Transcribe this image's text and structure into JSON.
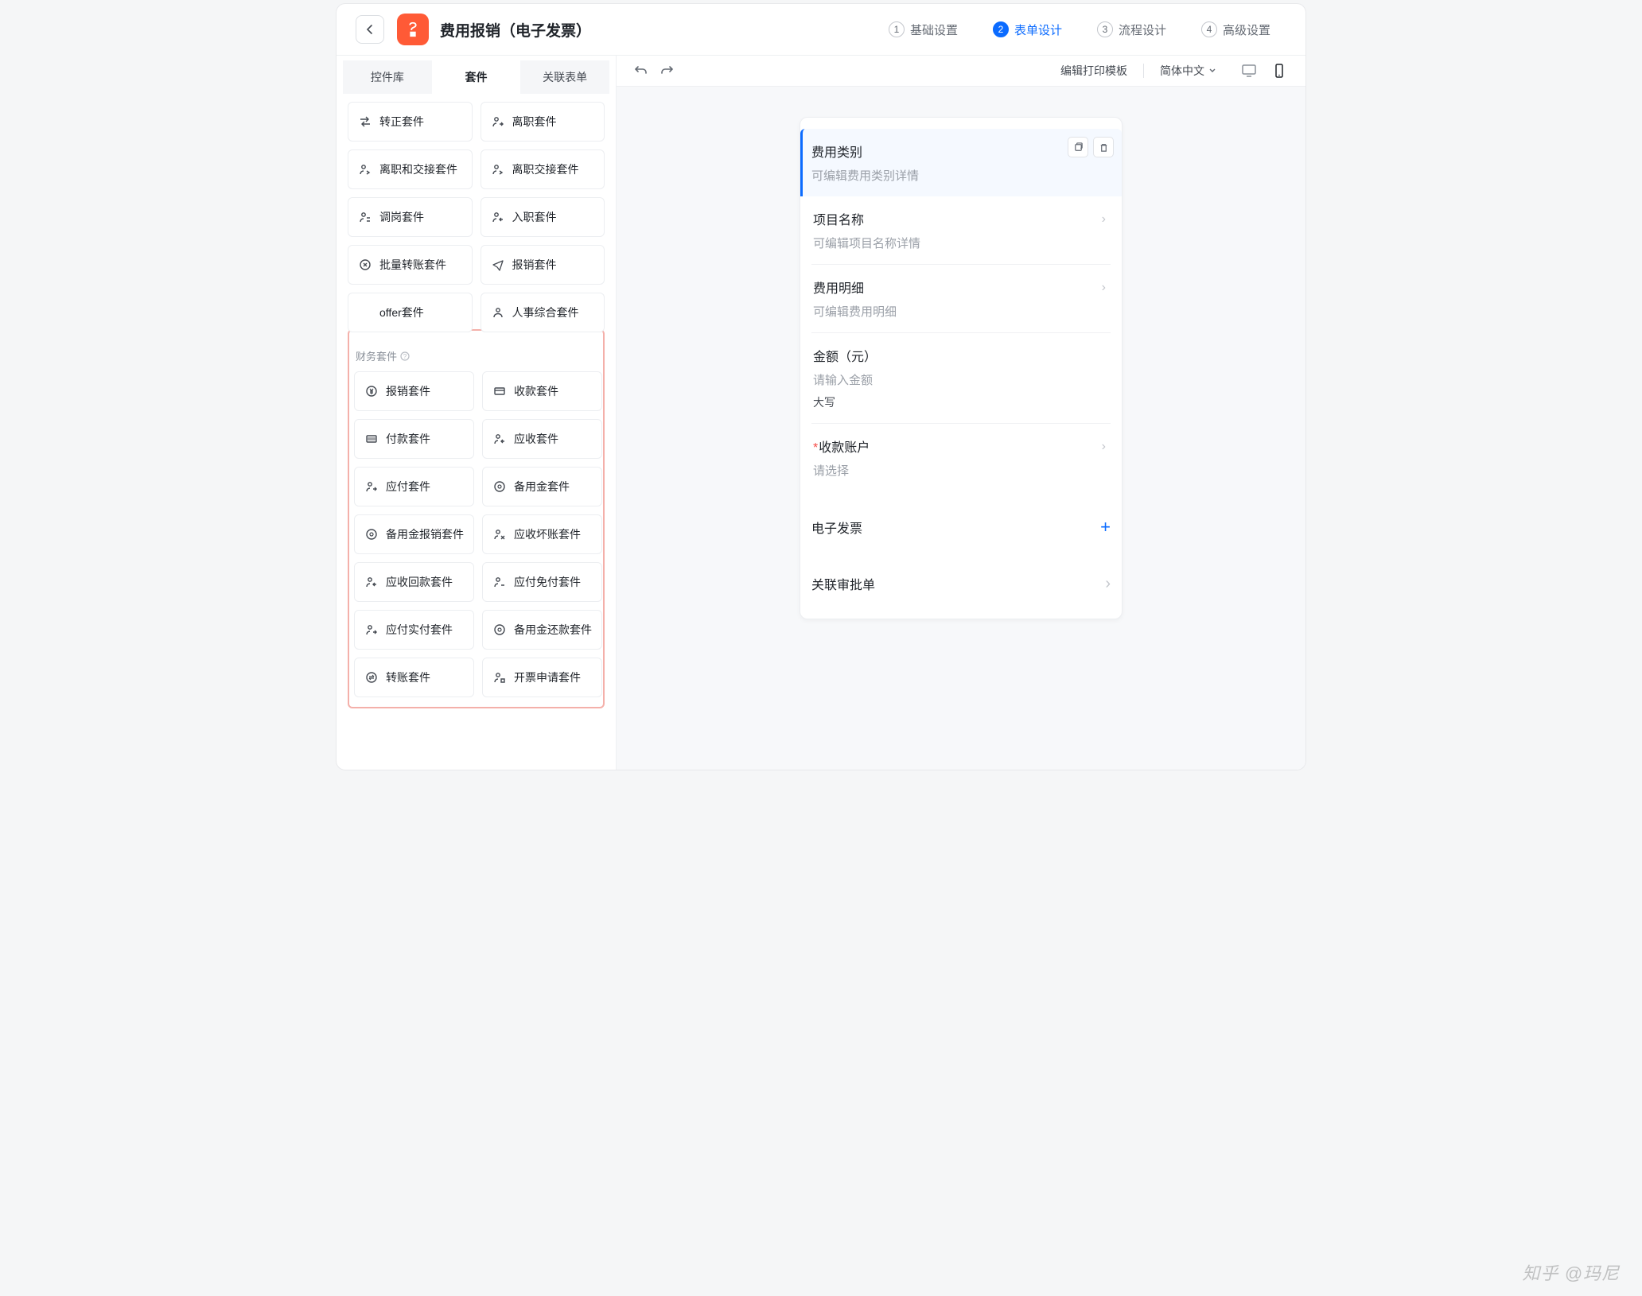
{
  "header": {
    "page_title": "费用报销（电子发票）"
  },
  "steps": [
    {
      "num": "1",
      "label": "基础设置"
    },
    {
      "num": "2",
      "label": "表单设计"
    },
    {
      "num": "3",
      "label": "流程设计"
    },
    {
      "num": "4",
      "label": "高级设置"
    }
  ],
  "sidebar": {
    "tabs": [
      "控件库",
      "套件",
      "关联表单"
    ],
    "hr_kits": [
      {
        "icon": "swap",
        "label": "转正套件"
      },
      {
        "icon": "person-leave",
        "label": "离职套件"
      },
      {
        "icon": "person-handover",
        "label": "离职和交接套件"
      },
      {
        "icon": "person-handover2",
        "label": "离职交接套件"
      },
      {
        "icon": "person-move",
        "label": "调岗套件"
      },
      {
        "icon": "person-in",
        "label": "入职套件"
      },
      {
        "icon": "transfer-batch",
        "label": "批量转账套件"
      },
      {
        "icon": "plane",
        "label": "报销套件"
      },
      {
        "icon": "none",
        "label": "offer套件"
      },
      {
        "icon": "person-hr",
        "label": "人事综合套件"
      }
    ],
    "fin_title": "财务套件",
    "fin_kits": [
      {
        "icon": "yen",
        "label": "报销套件"
      },
      {
        "icon": "card",
        "label": "收款套件"
      },
      {
        "icon": "barcode",
        "label": "付款套件"
      },
      {
        "icon": "person-ar",
        "label": "应收套件"
      },
      {
        "icon": "person-ap",
        "label": "应付套件"
      },
      {
        "icon": "reserve",
        "label": "备用金套件"
      },
      {
        "icon": "reserve-bx",
        "label": "备用金报销套件"
      },
      {
        "icon": "person-bad",
        "label": "应收坏账套件"
      },
      {
        "icon": "person-back",
        "label": "应收回款套件"
      },
      {
        "icon": "person-free",
        "label": "应付免付套件"
      },
      {
        "icon": "person-pay",
        "label": "应付实付套件"
      },
      {
        "icon": "reserve-ret",
        "label": "备用金还款套件"
      },
      {
        "icon": "transfer",
        "label": "转账套件"
      },
      {
        "icon": "person-inv",
        "label": "开票申请套件"
      }
    ]
  },
  "toolbar": {
    "print_template": "编辑打印模板",
    "language": "简体中文"
  },
  "form": {
    "f1": {
      "title": "费用类别",
      "sub": "可编辑费用类别详情"
    },
    "f2": {
      "title": "项目名称",
      "sub": "可编辑项目名称详情"
    },
    "f3": {
      "title": "费用明细",
      "sub": "可编辑费用明细"
    },
    "f4": {
      "title": "金额（元）",
      "ph": "请输入金额",
      "cap": "大写"
    },
    "f5": {
      "title": "收款账户",
      "ph": "请选择"
    },
    "f6": {
      "title": "电子发票"
    },
    "f7": {
      "title": "关联审批单"
    }
  },
  "watermark": "知乎 @玛尼"
}
